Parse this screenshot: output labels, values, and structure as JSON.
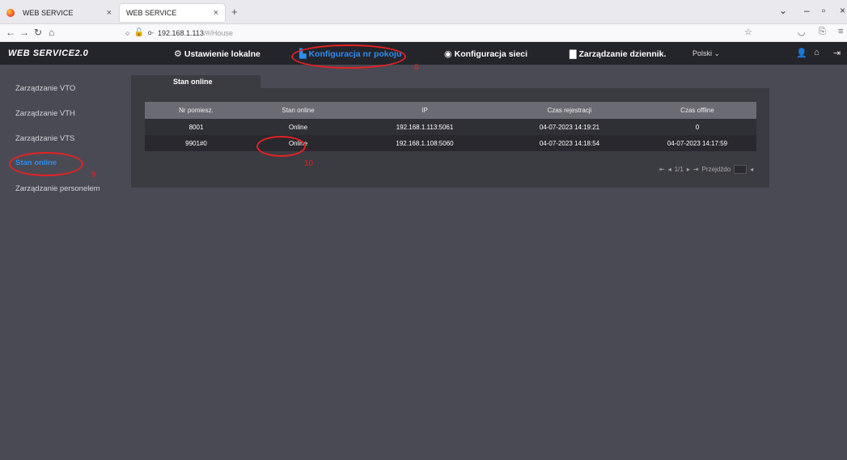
{
  "browser": {
    "tabs": [
      {
        "title": "WEB SERVICE"
      },
      {
        "title": "WEB SERVICE"
      }
    ],
    "url_host": "192.168.1.113",
    "url_path": "/#/House"
  },
  "app": {
    "logo": "WEB SERVICE2.0",
    "nav": [
      {
        "label": "Ustawienie lokalne",
        "icon": "gear-icon"
      },
      {
        "label": "Konfiguracja nr pokoju",
        "icon": "building-icon",
        "active": true
      },
      {
        "label": "Konfiguracja sieci",
        "icon": "globe-icon"
      },
      {
        "label": "Zarządzanie dziennik.",
        "icon": "log-icon"
      }
    ],
    "language": "Polski",
    "accent": "#2e8cf0"
  },
  "sidebar": {
    "items": [
      {
        "label": "Zarządzanie VTO"
      },
      {
        "label": "Zarządzanie VTH"
      },
      {
        "label": "Zarządzanie VTS"
      },
      {
        "label": "Stan online",
        "active": true
      },
      {
        "label": "Zarządzanie personelem"
      }
    ]
  },
  "panel": {
    "tab": "Stan online",
    "columns": [
      "Nr pomiesz.",
      "Stan online",
      "IP",
      "Czas rejestracji",
      "Czas offline"
    ],
    "rows": [
      [
        "8001",
        "Online",
        "192.168.1.113:5061",
        "04-07-2023 14:19:21",
        "0"
      ],
      [
        "9901#0",
        "Online",
        "192.168.1.108:5060",
        "04-07-2023 14:18:54",
        "04-07-2023 14:17:59"
      ]
    ],
    "pager": {
      "page": "1/1",
      "goto_label": "Przejdźdo"
    }
  },
  "annotations": {
    "a8": "8",
    "a9": "9",
    "a10": "10",
    "color": "#e42222"
  }
}
